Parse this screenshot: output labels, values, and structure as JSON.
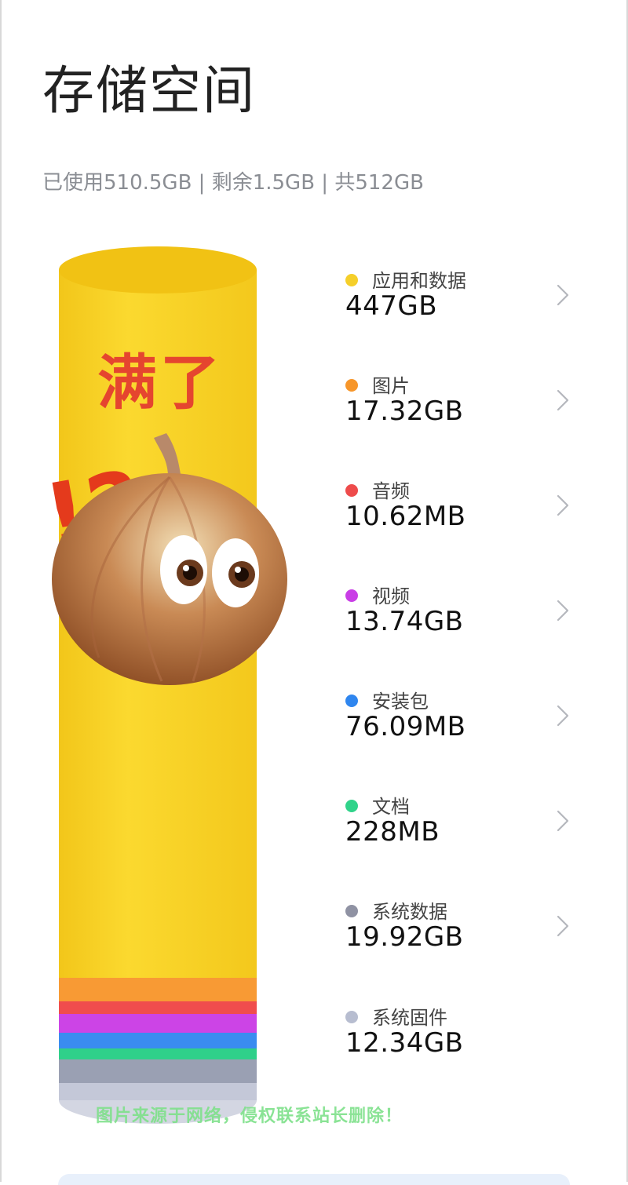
{
  "title": "存储空间",
  "summary": "已使用510.5GB | 剩余1.5GB | 共512GB",
  "sticker_text": "满了",
  "sticker_marks": "!?",
  "watermark": "图片来源于网络，侵权联系站长删除！",
  "categories": [
    {
      "label": "应用和数据",
      "value": "447GB",
      "color": "#f5cf2a",
      "chevron": true
    },
    {
      "label": "图片",
      "value": "17.32GB",
      "color": "#f7962a",
      "chevron": true
    },
    {
      "label": "音频",
      "value": "10.62MB",
      "color": "#ee4b4b",
      "chevron": true
    },
    {
      "label": "视频",
      "value": "13.74GB",
      "color": "#c93ee6",
      "chevron": true
    },
    {
      "label": "安装包",
      "value": "76.09MB",
      "color": "#2f86ef",
      "chevron": true
    },
    {
      "label": "文档",
      "value": "228MB",
      "color": "#30d38a",
      "chevron": true
    },
    {
      "label": "系统数据",
      "value": "19.92GB",
      "color": "#8f92a3",
      "chevron": true
    },
    {
      "label": "系统固件",
      "value": "12.34GB",
      "color": "#b7bdd0",
      "chevron": false
    }
  ],
  "chevron_icon": "chevron-right-icon"
}
